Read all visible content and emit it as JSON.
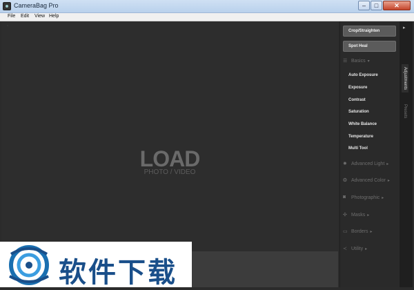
{
  "window": {
    "title": "CameraBag Pro",
    "controls": {
      "minimize": "–",
      "maximize": "□",
      "close": "✕"
    }
  },
  "menu": [
    "File",
    "Edit",
    "View",
    "Help"
  ],
  "canvas": {
    "load_title": "LOAD",
    "load_subtitle": "PHOTO / VIDEO"
  },
  "panel": {
    "crop_button": "Crop/Straighten",
    "heal_button": "Spot Heal",
    "basics": {
      "label": "Basics",
      "items": [
        "Auto Exposure",
        "Exposure",
        "Contrast",
        "Saturation",
        "White Balance",
        "Temperature",
        "Multi Tool"
      ]
    },
    "sections": [
      "Advanced Light",
      "Advanced Color",
      "Photographic",
      "Masks",
      "Borders",
      "Utility"
    ],
    "arrow": "▸"
  },
  "tabs": {
    "active": "Adjustments",
    "inactive": "Presets",
    "toggle": "▸"
  },
  "watermark": {
    "text": "软件下载"
  },
  "icons": {
    "basics": "sliders-icon",
    "sections": [
      "sun-icon",
      "palette-icon",
      "camera-icon",
      "mask-icon",
      "border-icon",
      "utility-icon"
    ]
  },
  "colors": {
    "panel_bg": "#2a2a2a",
    "canvas_bg": "#2d2d2d",
    "watermark_blue": "#1a4f8a"
  }
}
